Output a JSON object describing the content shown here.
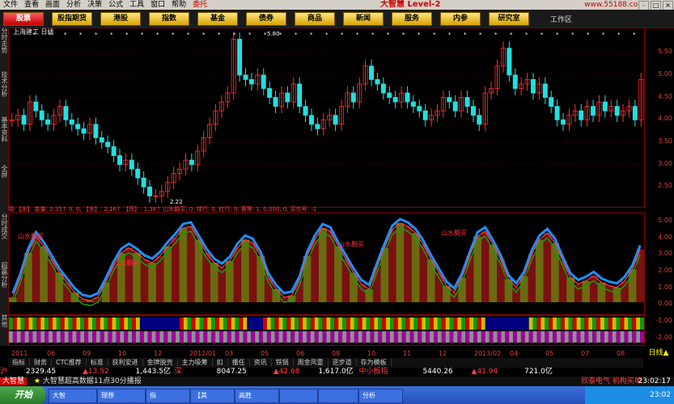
{
  "menu": [
    "文件",
    "查看",
    "画面",
    "分析",
    "决策",
    "公式",
    "工具",
    "窗口",
    "帮助",
    "委托"
  ],
  "brand": "大智慧 Level-2",
  "url_text": "www.55188.com",
  "window_controls": [
    "-",
    "□",
    "×"
  ],
  "nav": [
    {
      "label": "股票",
      "active": true
    },
    {
      "label": "股指期货",
      "active": false
    },
    {
      "label": "港股",
      "active": false
    },
    {
      "label": "指数",
      "active": false
    },
    {
      "label": "基金",
      "active": false
    },
    {
      "label": "债券",
      "active": false
    },
    {
      "label": "商品",
      "active": false
    },
    {
      "label": "新闻",
      "active": false
    },
    {
      "label": "服务",
      "active": false
    },
    {
      "label": "内参",
      "active": false
    },
    {
      "label": "研究室",
      "active": false
    }
  ],
  "workspace_label": "工作区",
  "left_tabs": [
    "分时走势",
    "技术分析",
    "基本资料",
    "全屏",
    "分时成交",
    "超赢分析",
    "其他"
  ],
  "stock_title": "上海建工 日线",
  "price_max_label": "5.80",
  "price_min_label": "2.22",
  "main_axis": [
    "5.50",
    "5.00",
    "4.50",
    "4.00",
    "3.50",
    "3.00",
    "2.50"
  ],
  "ind_axis": [
    "5.00",
    "4.00",
    "3.00",
    "2.00",
    "1.00",
    "0.00",
    "-1.00",
    "-2.00"
  ],
  "ind_line": "融-【龙】 能量: 2.35↑ 0, 0, 【龙】: 2.16↑ 【凤】: 1.38↑ 山水翻买: 0, 绿行: 0, 红行: 0, 黄等: 1, 0.000, 0, 买信号: -1",
  "annotations": [
    "山水翻买",
    "山水翻买",
    "山水翻买",
    "山水翻买"
  ],
  "dates": [
    "2011",
    "06",
    "09",
    "10",
    "12",
    "2012/01",
    "03",
    "05",
    "06",
    "08",
    "10",
    "11",
    "12",
    "2013/02",
    "04",
    "05",
    "07",
    "08"
  ],
  "period_label": "日线▲",
  "bottom_tabs": [
    "指标",
    "财务",
    "CTC推荐",
    "标准",
    "获利安进",
    "金牌脱壳",
    "主力吸筹",
    "扣",
    "播任",
    "资讯",
    "铁锅",
    "周金风雷",
    "逆步道",
    "存为模板"
  ],
  "ticker": [
    {
      "name": "沪",
      "value": "2329.45",
      "chg": "▲13.52",
      "amt": "1,443.5亿"
    },
    {
      "name": "深",
      "value": "8047.25",
      "chg": "▲42.68",
      "amt": "1,617.0亿"
    },
    {
      "name": "中小板指",
      "value": "5440.26",
      "chg": "▲41.94",
      "amt": "721.0亿"
    }
  ],
  "news_source": "大智慧",
  "news_text": "大智慧超高数据11点30分播报",
  "news_right": "欣泰电气 机构买单",
  "clock": "23:02:17",
  "start_label": "开始",
  "task_items": [
    "大智",
    "理想",
    "指",
    "【其",
    "高胜",
    "",
    "",
    "分析"
  ],
  "tray_time": "23:02",
  "chart_data": {
    "type": "line",
    "title": "上海建工 日线",
    "y_ticks": [
      5.5,
      5.0,
      4.5,
      4.0,
      3.5,
      3.0,
      2.5
    ],
    "ylim": [
      2.2,
      5.9
    ],
    "price": [
      4.0,
      4.1,
      3.9,
      4.4,
      4.2,
      4.0,
      3.9,
      4.1,
      4.3,
      4.0,
      3.9,
      3.8,
      3.7,
      3.9,
      3.6,
      3.5,
      3.4,
      3.2,
      3.0,
      3.1,
      2.9,
      2.7,
      2.5,
      2.3,
      2.3,
      2.4,
      2.6,
      2.8,
      2.9,
      3.1,
      3.0,
      3.3,
      3.6,
      3.9,
      4.2,
      4.4,
      4.6,
      5.8,
      5.0,
      4.9,
      4.8,
      5.0,
      4.7,
      4.5,
      4.3,
      4.6,
      4.4,
      4.8,
      4.3,
      4.1,
      3.9,
      3.8,
      4.0,
      4.1,
      3.9,
      4.3,
      4.6,
      4.4,
      4.8,
      5.2,
      4.9,
      4.8,
      4.6,
      4.5,
      4.4,
      4.6,
      4.4,
      4.3,
      4.2,
      4.0,
      4.1,
      4.2,
      4.5,
      4.4,
      4.2,
      4.5,
      4.3,
      4.1,
      3.9,
      4.6,
      4.7,
      5.2,
      5.6,
      5.0,
      4.7,
      4.8,
      4.9,
      4.6,
      4.8,
      4.5,
      4.3,
      4.0,
      3.9,
      4.1,
      4.2,
      4.0,
      4.3,
      4.1,
      4.4,
      4.2,
      4.3,
      4.1,
      4.2,
      4.3,
      4.0,
      4.9
    ],
    "indicator": [
      0.3,
      1.5,
      3.0,
      4.0,
      3.4,
      2.6,
      1.8,
      1.2,
      0.6,
      0.2,
      0.1,
      0.3,
      1.2,
      2.2,
      3.0,
      3.3,
      3.0,
      2.6,
      2.4,
      2.8,
      3.4,
      3.9,
      4.5,
      4.6,
      3.8,
      3.0,
      2.4,
      2.1,
      2.5,
      3.3,
      3.8,
      3.6,
      2.8,
      1.5,
      0.8,
      0.3,
      0.4,
      1.3,
      2.8,
      3.8,
      4.5,
      4.3,
      3.4,
      2.6,
      1.8,
      1.1,
      0.8,
      2.1,
      3.3,
      4.4,
      4.8,
      4.6,
      4.2,
      3.5,
      2.6,
      1.8,
      1.0,
      0.6,
      1.5,
      2.8,
      4.0,
      4.3,
      3.5,
      2.6,
      1.4,
      0.9,
      1.6,
      2.9,
      3.8,
      4.2,
      3.6,
      2.5,
      1.5,
      1.1,
      1.3,
      1.6,
      1.2,
      1.0,
      0.9,
      1.3,
      2.0,
      3.2
    ],
    "ind_ylim": [
      -2.3,
      5.2
    ]
  }
}
